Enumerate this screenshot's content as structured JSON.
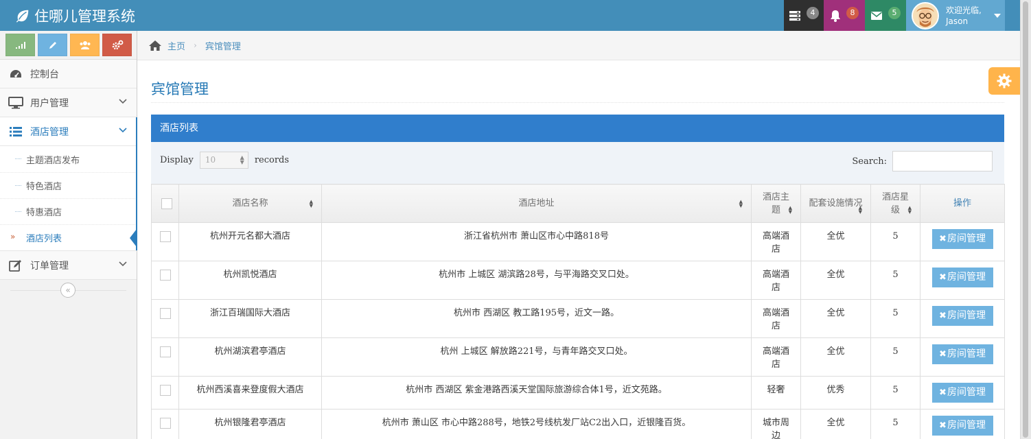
{
  "app": {
    "title": "住哪儿管理系统"
  },
  "navbar": {
    "tasks_count": "4",
    "notifications_count": "8",
    "messages_count": "5",
    "user_greeting": "欢迎光临,",
    "user_name": "Jason"
  },
  "sidebar": {
    "items": [
      {
        "label": "控制台"
      },
      {
        "label": "用户管理"
      },
      {
        "label": "酒店管理"
      },
      {
        "label": "订单管理"
      }
    ],
    "hotel_submenu": [
      {
        "label": "主题酒店发布"
      },
      {
        "label": "特色酒店"
      },
      {
        "label": "特惠酒店"
      },
      {
        "label": "酒店列表"
      }
    ]
  },
  "breadcrumb": {
    "home": "主页",
    "current": "宾馆管理"
  },
  "page": {
    "title": "宾馆管理",
    "table_title": "酒店列表"
  },
  "datatable": {
    "display_label": "Display",
    "page_size": "10",
    "records_label": "records",
    "search_label": "Search:",
    "columns": [
      "酒店名称",
      "酒店地址",
      "酒店主题",
      "配套设施情况",
      "酒店星级",
      "操作"
    ],
    "action_label": "房间管理",
    "rows": [
      {
        "name": "杭州开元名都大酒店",
        "address": "浙江省杭州市 萧山区市心中路818号",
        "theme": "高端酒店",
        "facilities": "全优",
        "stars": "5"
      },
      {
        "name": "杭州凯悦酒店",
        "address": "杭州市 上城区 湖滨路28号，与平海路交叉口处。",
        "theme": "高端酒店",
        "facilities": "全优",
        "stars": "5"
      },
      {
        "name": "浙江百瑞国际大酒店",
        "address": "杭州市 西湖区 教工路195号，近文一路。",
        "theme": "高端酒店",
        "facilities": "全优",
        "stars": "5"
      },
      {
        "name": "杭州湖滨君亭酒店",
        "address": "杭州 上城区 解放路221号，与青年路交叉口处。",
        "theme": "高端酒店",
        "facilities": "全优",
        "stars": "5"
      },
      {
        "name": "杭州西溪喜来登度假大酒店",
        "address": "杭州市 西湖区 紫金港路西溪天堂国际旅游综合体1号，近文苑路。",
        "theme": "轻奢",
        "facilities": "优秀",
        "stars": "5"
      },
      {
        "name": "杭州银隆君亭酒店",
        "address": "杭州市 萧山区 市心中路288号，地铁2号线杭发厂站C2出入口，近银隆百货。",
        "theme": "城市周边",
        "facilities": "全优",
        "stars": "5"
      }
    ]
  }
}
